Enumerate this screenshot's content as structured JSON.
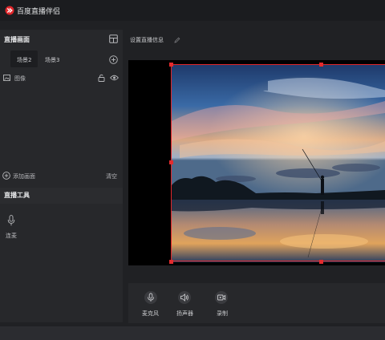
{
  "app": {
    "title": "百度直播伴侣"
  },
  "left_panel": {
    "section_title": "直播画面",
    "scenes": [
      {
        "label": "场景2",
        "active": true
      },
      {
        "label": "场景3",
        "active": false
      }
    ],
    "sources": [
      {
        "label": "图像"
      }
    ],
    "add_source_label": "添加画面",
    "clear_label": "清空",
    "tools_title": "直播工具",
    "tools": [
      {
        "label": "连麦",
        "icon": "microphone-icon"
      }
    ]
  },
  "main": {
    "info_title": "设置直播信息",
    "bottom_tools": [
      {
        "label": "麦克风",
        "icon": "microphone-icon"
      },
      {
        "label": "扬声器",
        "icon": "speaker-icon"
      },
      {
        "label": "录制",
        "icon": "record-icon"
      }
    ]
  },
  "colors": {
    "accent": "#e0262a",
    "panel": "#27282b",
    "background": "#202124"
  }
}
